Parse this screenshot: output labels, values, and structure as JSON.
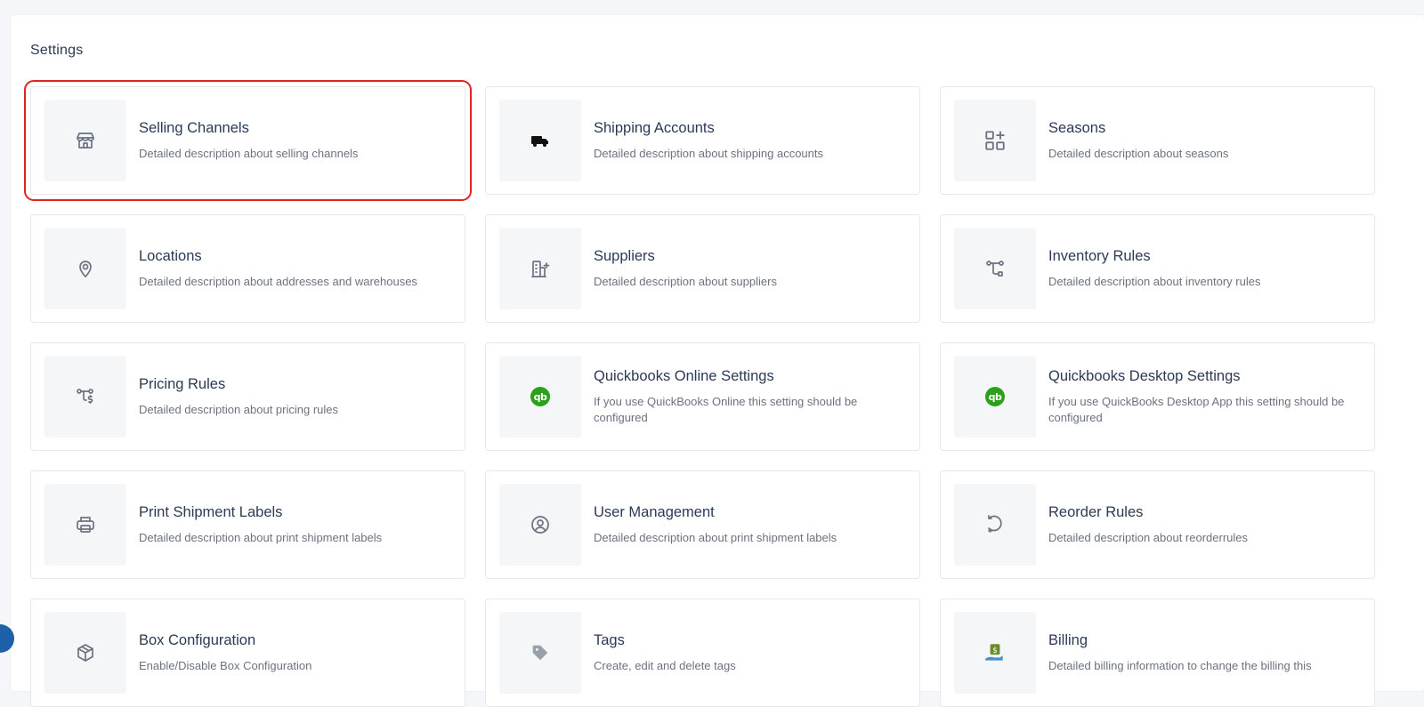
{
  "page": {
    "title": "Settings"
  },
  "cards": [
    {
      "title": "Selling Channels",
      "desc": "Detailed description about selling channels",
      "icon": "store-icon"
    },
    {
      "title": "Shipping Accounts",
      "desc": "Detailed description about shipping accounts",
      "icon": "truck-icon"
    },
    {
      "title": "Seasons",
      "desc": "Detailed description about seasons",
      "icon": "apps-add-icon"
    },
    {
      "title": "Locations",
      "desc": "Detailed description about addresses and warehouses",
      "icon": "map-pin-icon"
    },
    {
      "title": "Suppliers",
      "desc": "Detailed description about suppliers",
      "icon": "building-plus-icon"
    },
    {
      "title": "Inventory Rules",
      "desc": "Detailed description about inventory rules",
      "icon": "route-icon"
    },
    {
      "title": "Pricing Rules",
      "desc": "Detailed description about pricing rules",
      "icon": "route-dollar-icon"
    },
    {
      "title": "Quickbooks Online Settings",
      "desc": "If you use QuickBooks Online this setting should be configured",
      "icon": "quickbooks-icon",
      "badge": "qb"
    },
    {
      "title": "Quickbooks Desktop Settings",
      "desc": "If you use QuickBooks Desktop App this setting should be configured",
      "icon": "quickbooks-icon",
      "badge": "qb"
    },
    {
      "title": "Print Shipment Labels",
      "desc": "Detailed description about print shipment labels",
      "icon": "printer-icon"
    },
    {
      "title": "User Management",
      "desc": "Detailed description about print shipment labels",
      "icon": "user-circle-icon"
    },
    {
      "title": "Reorder Rules",
      "desc": "Detailed description about reorderrules",
      "icon": "rotate-icon"
    },
    {
      "title": "Box Configuration",
      "desc": "Enable/Disable Box Configuration",
      "icon": "box-icon"
    },
    {
      "title": "Tags",
      "desc": "Create, edit and delete tags",
      "icon": "tag-icon"
    },
    {
      "title": "Billing",
      "desc": "Detailed billing information to change the billing this",
      "icon": "billing-hand-icon"
    }
  ],
  "colors": {
    "accent_selected": "#e02424",
    "quickbooks": "#2ca01c",
    "help_bubble": "#1d5fa8"
  }
}
